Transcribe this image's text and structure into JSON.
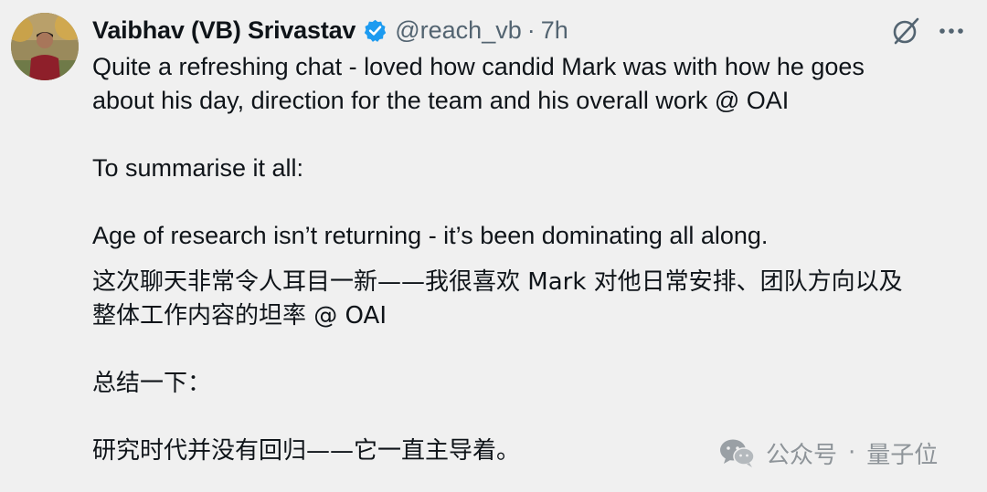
{
  "tweet": {
    "author": {
      "display_name": "Vaibhav (VB) Srivastav",
      "handle": "@reach_vb",
      "separator": "·",
      "time": "7h"
    },
    "icons": {
      "verified": "verified-badge-icon",
      "grok": "grok-icon",
      "more": "more-icon"
    },
    "colors": {
      "verified": "#1d9bf0",
      "text": "#0f1419",
      "secondary": "#536471",
      "background": "#f0f0f0"
    },
    "lines": [
      "Quite a refreshing chat - loved how candid Mark was with how he goes",
      "about his day, direction for the team and his overall work @ OAI",
      "To summarise it all:",
      "Age of research isn’t returning - it’s been dominating all along.",
      "这次聊天非常令人耳目一新——我很喜欢 Mark 对他日常安排、团队方向以及",
      "整体工作内容的坦率 @ OAI",
      "总结一下：",
      "研究时代并没有回归——它一直主导着。"
    ]
  },
  "watermark": {
    "icon": "wechat-icon",
    "label": "公众号",
    "separator": "·",
    "account": "量子位"
  }
}
